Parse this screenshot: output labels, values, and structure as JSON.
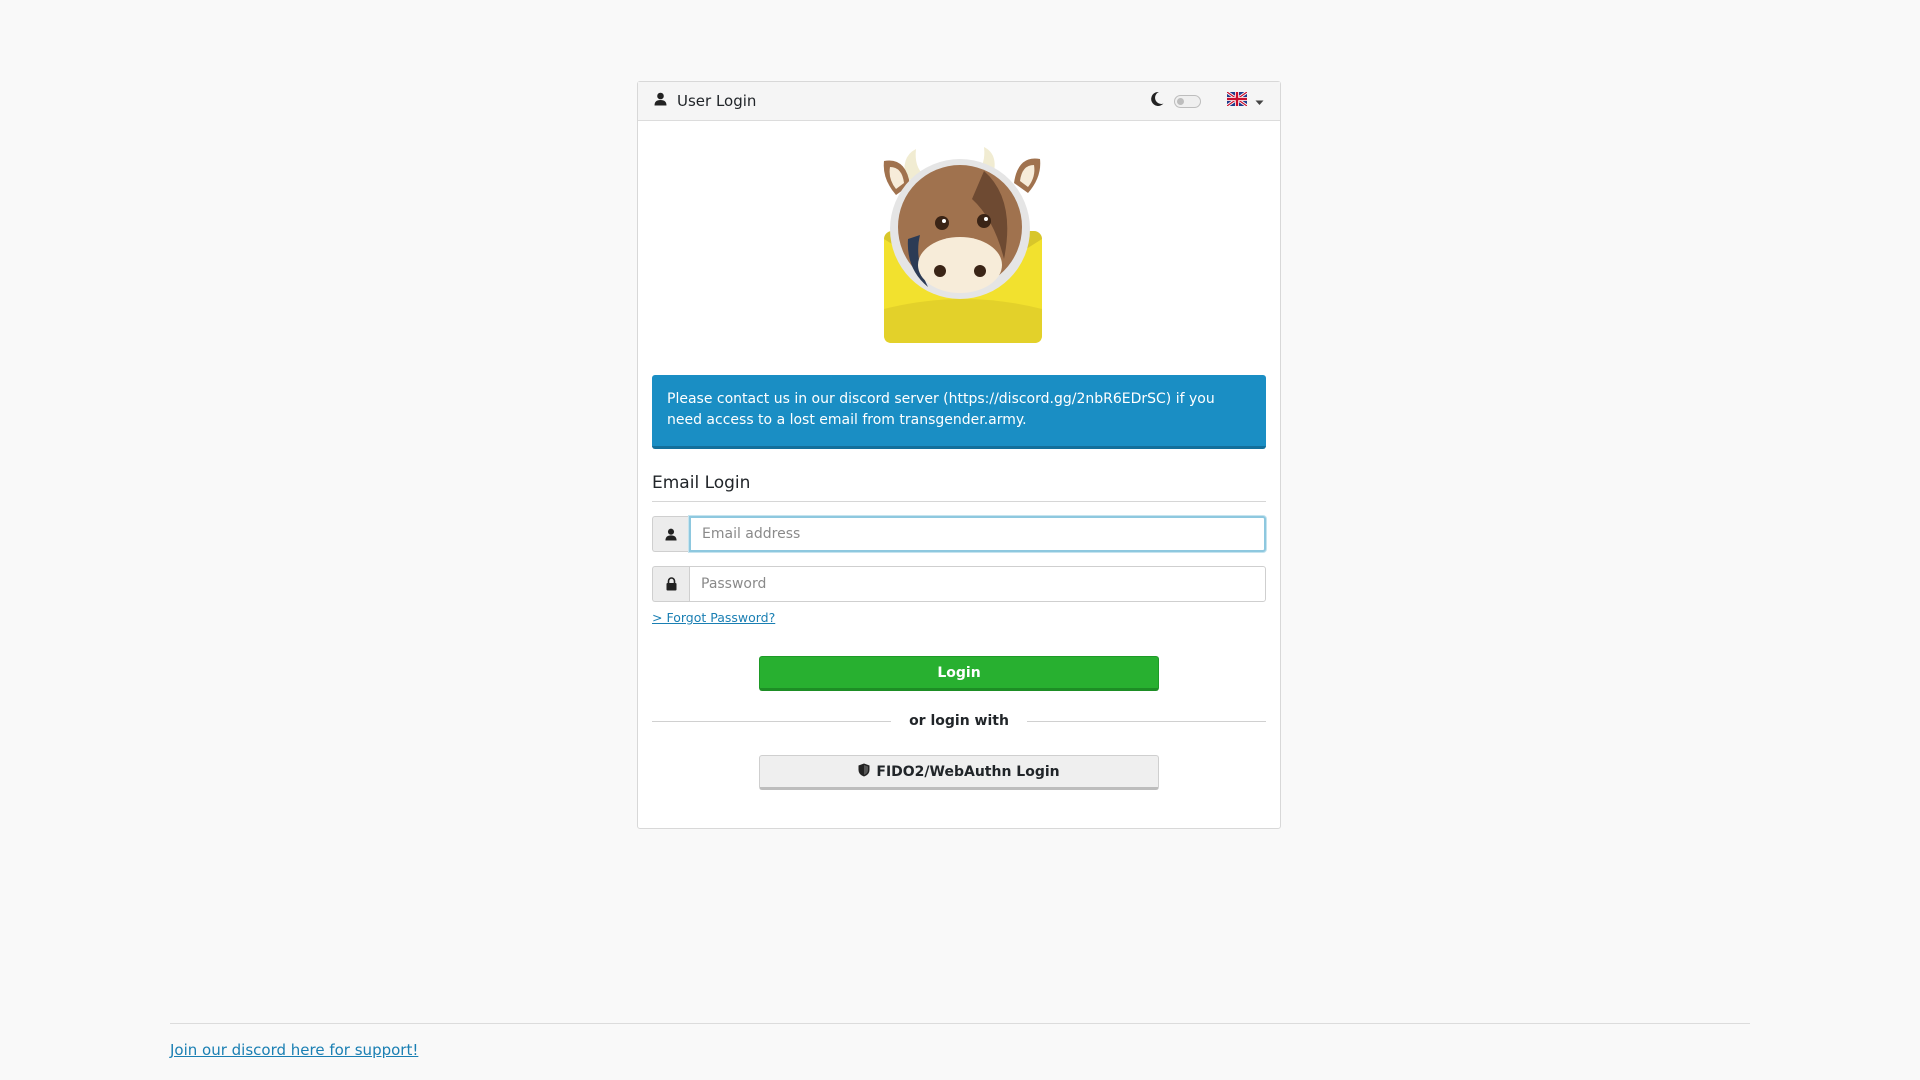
{
  "header": {
    "title": "User Login",
    "user_icon": "user-icon",
    "dark_mode_icon": "moon-icon",
    "language_flag": "uk-flag-icon"
  },
  "logo": {
    "icon": "cow-mail-logo"
  },
  "alert": {
    "text": "Please contact us in our discord server (https://discord.gg/2nbR6EDrSC) if you need access to a lost email from transgender.army."
  },
  "form": {
    "section_title": "Email Login",
    "email_placeholder": "Email address",
    "email_value": "",
    "password_placeholder": "Password",
    "password_value": "",
    "forgot_label": "> Forgot Password?",
    "login_label": "Login",
    "or_label": "or login with",
    "fido_label": "FIDO2/WebAuthn Login"
  },
  "footer": {
    "link_label": "Join our discord here for support!"
  },
  "colors": {
    "alert_bg": "#1a8ec4",
    "login_btn": "#28b030",
    "link": "#1a7fb3"
  }
}
